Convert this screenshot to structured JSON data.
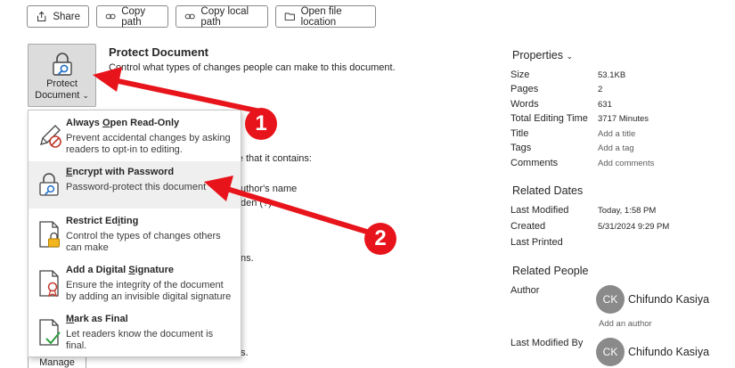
{
  "toolbar": {
    "share": "Share",
    "copy_path": "Copy path",
    "copy_local_path": "Copy local path",
    "open_file_location": "Open file location"
  },
  "protect": {
    "tile_label_line1": "Protect",
    "tile_label_line2": "Document",
    "tile_chevron": "⌄",
    "title": "Protect Document",
    "description": "Control what types of changes people can make to this document."
  },
  "menu": {
    "items": [
      {
        "title_pre": "Always ",
        "title_ul": "O",
        "title_post": "pen Read-Only",
        "desc": "Prevent accidental changes by asking readers to opt-in to editing."
      },
      {
        "title_pre": "",
        "title_ul": "E",
        "title_post": "ncrypt with Password",
        "desc": "Password-protect this document"
      },
      {
        "title_pre": "Restrict Ed",
        "title_ul": "i",
        "title_post": "ting",
        "desc": "Control the types of changes others can make"
      },
      {
        "title_pre": "Add a Digital ",
        "title_ul": "S",
        "title_post": "ignature",
        "desc": "Ensure the integrity of the document by adding an invisible digital signature"
      },
      {
        "title_pre": "",
        "title_ul": "M",
        "title_post": "ark as Final",
        "desc": "Let readers know the document is final."
      }
    ]
  },
  "background": {
    "frag1": "are that it contains:",
    "frag2": "uthor's name",
    "frag3": "den (?)",
    "frag4": "ns.",
    "manage_label": "Manage"
  },
  "properties": {
    "header": "Properties",
    "chevron": "⌄",
    "rows": [
      {
        "label": "Size",
        "value": "53.1KB"
      },
      {
        "label": "Pages",
        "value": "2"
      },
      {
        "label": "Words",
        "value": "631"
      },
      {
        "label": "Total Editing Time",
        "value": "3717 Minutes"
      },
      {
        "label": "Title",
        "value": "Add a title"
      },
      {
        "label": "Tags",
        "value": "Add a tag"
      },
      {
        "label": "Comments",
        "value": "Add comments"
      }
    ],
    "related_dates_header": "Related Dates",
    "dates": [
      {
        "label": "Last Modified",
        "value": "Today, 1:58 PM"
      },
      {
        "label": "Created",
        "value": "5/31/2024 9:29 PM"
      },
      {
        "label": "Last Printed",
        "value": ""
      }
    ],
    "related_people_header": "Related People",
    "author_label": "Author",
    "author_initials": "CK",
    "author_name": "Chifundo Kasiya",
    "add_author": "Add an author",
    "last_modified_by_label": "Last Modified By",
    "modifier_initials": "CK",
    "modifier_name": "Chifundo Kasiya"
  },
  "annotations": {
    "badge1": "1",
    "badge2": "2",
    "arrow_color": "#e8141b"
  }
}
